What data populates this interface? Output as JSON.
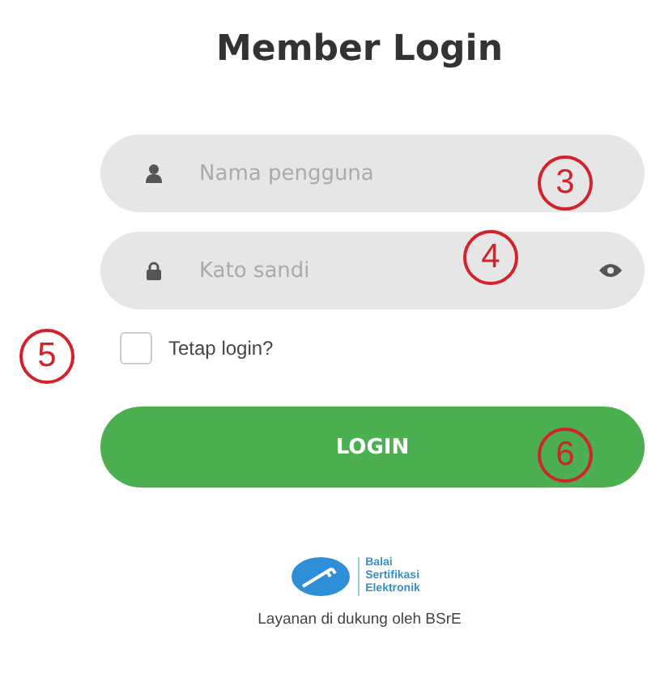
{
  "title": "Member Login",
  "fields": [
    {
      "kind": "text",
      "placeholder": "Nama pengguna"
    },
    {
      "kind": "password",
      "placeholder": "Kato sandi"
    }
  ],
  "remember": {
    "label": "Tetap login?",
    "checked": false
  },
  "login_button": "LOGIN",
  "logo": {
    "lines": [
      "Balai",
      "Sertifikasi",
      "Elektronik"
    ]
  },
  "footer": "Layanan di dukung oleh BSrE",
  "annotations": [
    "3",
    "4",
    "5",
    "6"
  ]
}
